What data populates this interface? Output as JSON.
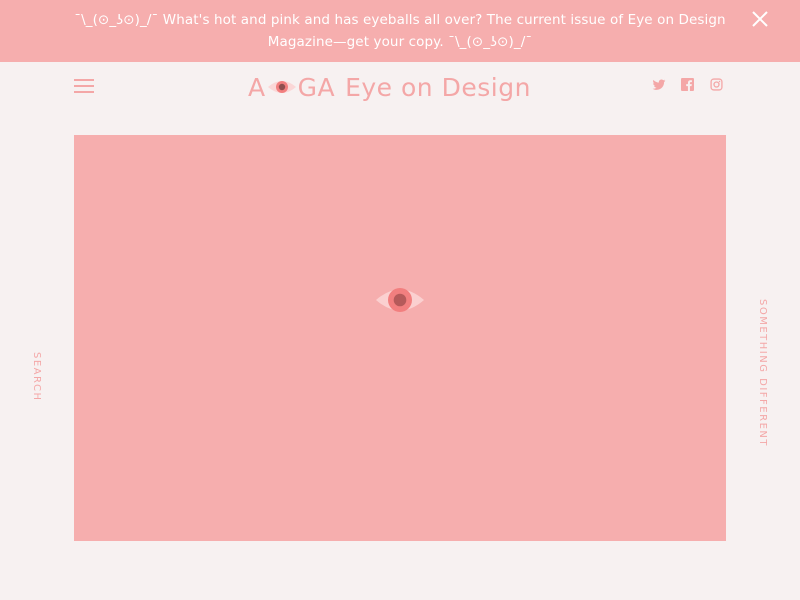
{
  "banner": {
    "message": "¯\\_(⊙_ʖ⊙)_/¯ What's hot and pink and has eyeballs all over? The current issue of Eye on Design Magazine—get your copy. ¯\\_(⊙_ʖ⊙)_/¯",
    "close_icon": "close-icon"
  },
  "header": {
    "menu_icon": "hamburger-menu-icon",
    "logo": {
      "a": "A",
      "ga": "GA",
      "rest": "Eye on Design"
    },
    "social": [
      "twitter-icon",
      "facebook-icon",
      "instagram-icon"
    ]
  },
  "sidebar": {
    "left_label": "SEARCH",
    "right_label": "SOMETHING DIFFERENT"
  },
  "colors": {
    "brand_pink": "#f6aeae",
    "text_pink": "#f4a7a7",
    "background": "#f7f1f1",
    "eye_iris": "#f27f7f",
    "eye_pupil": "#b55a5a"
  }
}
